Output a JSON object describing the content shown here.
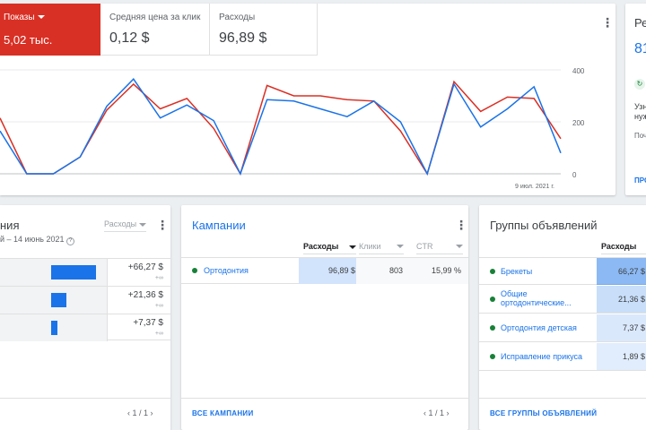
{
  "performance": {
    "metrics": {
      "shows": {
        "label": "Показы",
        "value": "5,02 тыс."
      },
      "cpc": {
        "label": "Средняя цена за клик",
        "value": "0,12 $"
      },
      "cost": {
        "label": "Расходы",
        "value": "96,89 $"
      }
    },
    "menu_icon": "more-vert-icon",
    "chart": {
      "type": "line",
      "y_ticks": [
        "400",
        "200",
        "0"
      ],
      "ylim": [
        0,
        400
      ],
      "x_label": "9 июл. 2021 г.",
      "series": [
        {
          "color": "#d93025",
          "values": [
            215,
            0,
            0,
            65,
            245,
            345,
            250,
            290,
            175,
            0,
            340,
            300,
            300,
            285,
            280,
            165,
            0,
            355,
            240,
            295,
            290,
            135
          ]
        },
        {
          "color": "#1a73e8",
          "values": [
            165,
            0,
            0,
            65,
            260,
            365,
            215,
            265,
            205,
            0,
            285,
            280,
            250,
            220,
            280,
            200,
            0,
            345,
            180,
            250,
            335,
            80
          ]
        }
      ]
    }
  },
  "reco": {
    "title": "Рек",
    "value": "81",
    "icon": "refresh-icon",
    "text_line1": "Узна",
    "text_line2": "нужн",
    "link": "Почему",
    "button": "ПРОС"
  },
  "ads": {
    "title": "ния",
    "column": "Расходы",
    "date": "й – 14 июнь 2021",
    "help_icon": "help-icon",
    "rows": [
      {
        "value": "+66,27 $",
        "delta": "+∞",
        "share": 0.97
      },
      {
        "value": "+21,36 $",
        "delta": "+∞",
        "share": 0.33
      },
      {
        "value": "+7,37 $",
        "delta": "+∞",
        "share": 0.14
      }
    ],
    "pager": "1 / 1"
  },
  "campaigns": {
    "title": "Кампании",
    "columns": [
      "Расходы",
      "Клики",
      "CTR"
    ],
    "rows": [
      {
        "name": "Ортодонтия",
        "cost": "96,89 $",
        "clicks": "803",
        "ctr": "15,99 %"
      }
    ],
    "footer_link": "ВСЕ КАМПАНИИ",
    "pager": "1 / 1"
  },
  "groups": {
    "title": "Группы объявлений",
    "column": "Расходы",
    "rows": [
      {
        "name_line1": "Брекеты",
        "name_line2": "",
        "cost": "66,27 $",
        "share": 1.0
      },
      {
        "name_line1": "Общие",
        "name_line2": "ортодонтические...",
        "cost": "21,36 $",
        "share": 0.32
      },
      {
        "name_line1": "Ортодонтия детская",
        "name_line2": "",
        "cost": "7,37 $",
        "share": 0.11
      },
      {
        "name_line1": "Исправление прикуса",
        "name_line2": "",
        "cost": "1,89 $",
        "share": 0.03
      }
    ],
    "footer_link": "ВСЕ ГРУППЫ ОБЪЯВЛЕНИЙ"
  }
}
